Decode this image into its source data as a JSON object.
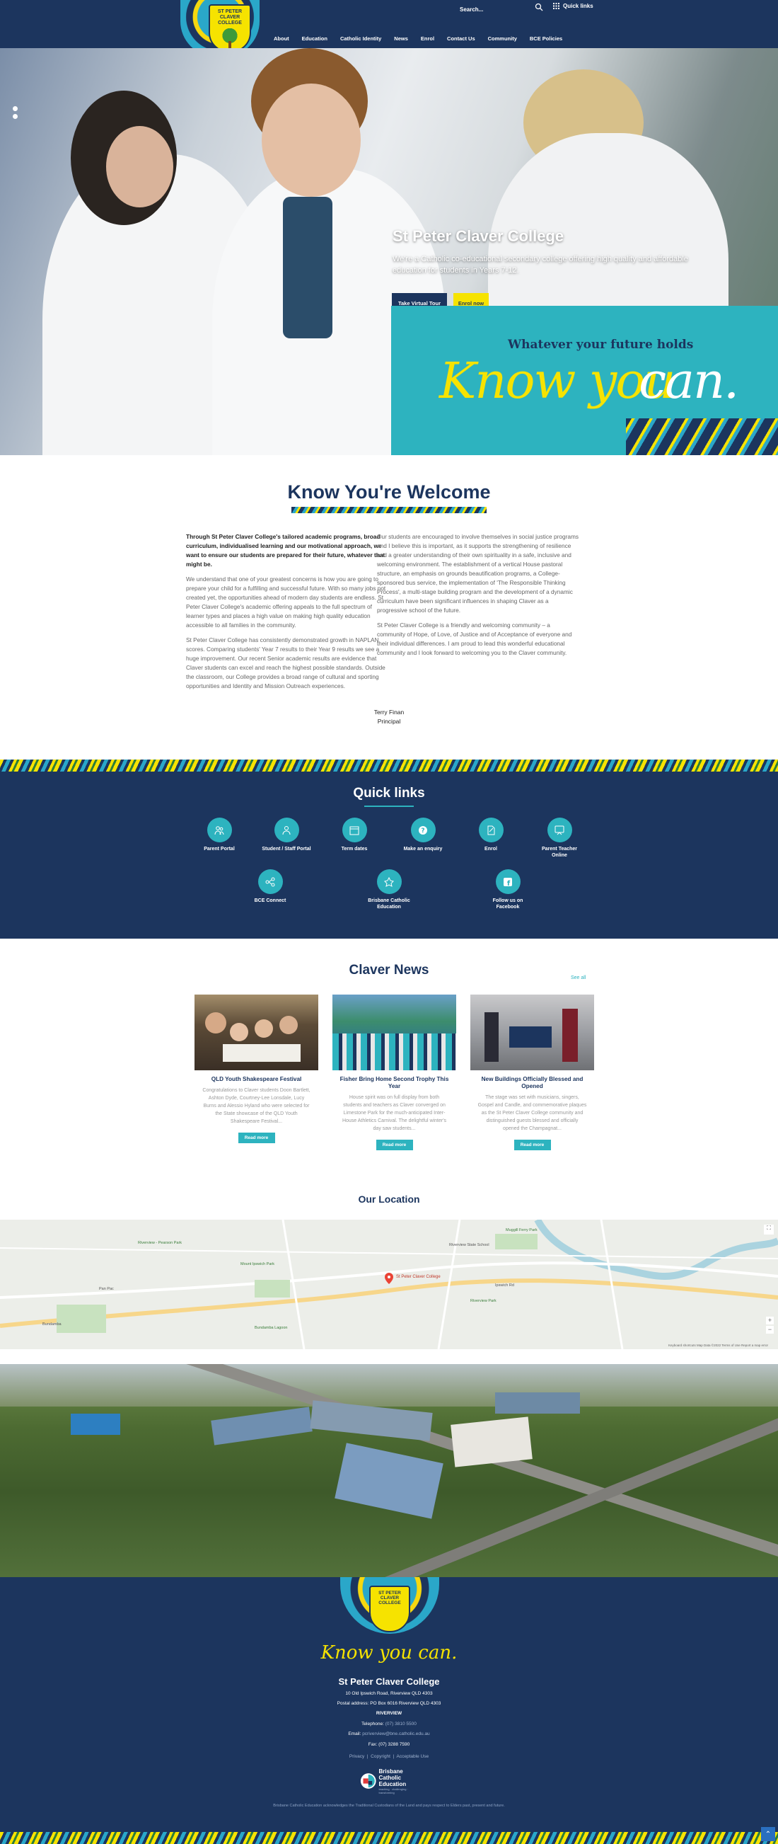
{
  "header": {
    "logo_text": "ST PETER CLAVER COLLEGE",
    "search_placeholder": "Search...",
    "quick_links_label": "Quick links",
    "nav": [
      "About",
      "Education",
      "Catholic Identity",
      "News",
      "Enrol",
      "Contact Us",
      "Community",
      "BCE Policies"
    ]
  },
  "hero": {
    "title": "St Peter Claver College",
    "subtitle": "We're a Catholic co-educational secondary college offering high quality and affordable education for students in Years 7-12.",
    "virtual_tour": "Take Virtual Tour",
    "enrol": "Enrol now",
    "banner_tagline": "Whatever your future holds",
    "banner_know": "Know you",
    "banner_can": "can."
  },
  "welcome": {
    "title": "Know You're Welcome",
    "left": [
      "Through St Peter Claver College's tailored academic programs, broad curriculum, individualised learning and our motivational approach, we want to ensure our students are prepared for their future, whatever that might be.",
      "We understand that one of your greatest concerns is how you are going to prepare your child for a fulfilling and successful future. With so many jobs not created yet, the opportunities ahead of modern day students are endless. St Peter Claver College's academic offering appeals to the full spectrum of learner types and places a high value on making high quality education accessible to all families in the community.",
      "St Peter Claver College has consistently demonstrated growth in NAPLAN scores. Comparing students' Year 7 results to their Year 9 results we see a huge improvement. Our recent Senior academic results are evidence that Claver students can excel and reach the highest possible standards. Outside the classroom, our College provides a broad range of cultural and sporting opportunities and Identity and Mission Outreach experiences."
    ],
    "right": [
      "Our students are encouraged to involve themselves in social justice programs and I believe this is important, as it supports the strengthening of resilience and a greater understanding of their own spirituality in a safe, inclusive and welcoming environment. The establishment of a vertical House pastoral structure, an emphasis on grounds beautification programs, a College-sponsored bus service, the implementation of 'The Responsible Thinking Process', a multi-stage building program and the development of a dynamic curriculum have been significant influences in shaping Claver as a progressive school of the future.",
      "St Peter Claver College is a friendly and welcoming community – a community of Hope, of Love, of Justice and of Acceptance of everyone and their individual differences. I am proud to lead this wonderful educational community and I look forward to welcoming you to the Claver community."
    ],
    "signature_name": "Terry Finan",
    "signature_role": "Principal"
  },
  "quick_links": {
    "title": "Quick links",
    "items": [
      {
        "label": "Parent Portal",
        "icon": "parents-icon"
      },
      {
        "label": "Student / Staff Portal",
        "icon": "user-icon"
      },
      {
        "label": "Term dates",
        "icon": "calendar-icon"
      },
      {
        "label": "Make an enquiry",
        "icon": "question-icon"
      },
      {
        "label": "Enrol",
        "icon": "enrol-icon"
      },
      {
        "label": "Parent Teacher Online",
        "icon": "parent-teacher-icon"
      },
      {
        "label": "BCE Connect",
        "icon": "connect-icon"
      },
      {
        "label": "Brisbane Catholic Education",
        "icon": "bce-icon"
      },
      {
        "label": "Follow us on Facebook",
        "icon": "facebook-icon"
      }
    ]
  },
  "news": {
    "title": "Claver News",
    "see_all": "See all",
    "read_more": "Read more",
    "items": [
      {
        "title": "QLD Youth Shakespeare Festival",
        "excerpt": "Congratulations to Claver students Doon Bartlett, Ashton Dyde, Courtney-Lee Lonsdale, Lucy Burns and Alessio Hyland who were selected for the State showcase of the QLD Youth Shakespeare Festival..."
      },
      {
        "title": "Fisher Bring Home Second Trophy This Year",
        "excerpt": "House spirit was on full display from both students and teachers as Claver converged on Limestone Park for the much-anticipated Inter-House Athletics Carnival. The delightful winter's day saw students..."
      },
      {
        "title": "New Buildings Officially Blessed and Opened",
        "excerpt": "The stage was set with musicians, singers, Gospel and Candle, and commemorative plaques as the St Peter Claver College community and distinguished guests blessed and officially opened the Champagnat..."
      }
    ]
  },
  "location": {
    "title": "Our Location",
    "map_label": "St Peter Claver College",
    "map_places": [
      "Riverview State School",
      "Mount Ipswich Park",
      "Riverview Park",
      "Ipswich Rd",
      "Pan Pac",
      "Bundamba",
      "Riverview - Pearson Park",
      "Bundamba Lagoon",
      "Muggill Ferry Park"
    ],
    "map_attribution": "Keyboard shortcuts  Map Data ©2022  Terms of Use  Report a map error"
  },
  "footer": {
    "logo_text": "ST PETER CLAVER COLLEGE",
    "tagline": "Know you can.",
    "name": "St Peter Claver College",
    "address": "10 Old Ipswich Road, Riverview QLD 4303",
    "postal": "Postal address: PO Box 6016 Riverview QLD 4303",
    "region": "RIVERVIEW",
    "telephone_label": "Telephone:",
    "telephone": "(07) 3810 5500",
    "email_label": "Email:",
    "email": "pcriverview@bne.catholic.edu.au",
    "fax": "Fax: (07) 3288 7590",
    "links": [
      "Privacy",
      "Copyright",
      "Acceptable Use"
    ],
    "bce_name": "Brisbane Catholic Education",
    "bce_motto": "teaching · challenging · transforming",
    "acknowledgement": "Brisbane Catholic Education acknowledges the Traditional Custodians of the Land and pays respect to Elders past, present and future."
  },
  "colors": {
    "navy": "#1c355e",
    "teal": "#2db3bf",
    "yellow": "#f6e300"
  }
}
